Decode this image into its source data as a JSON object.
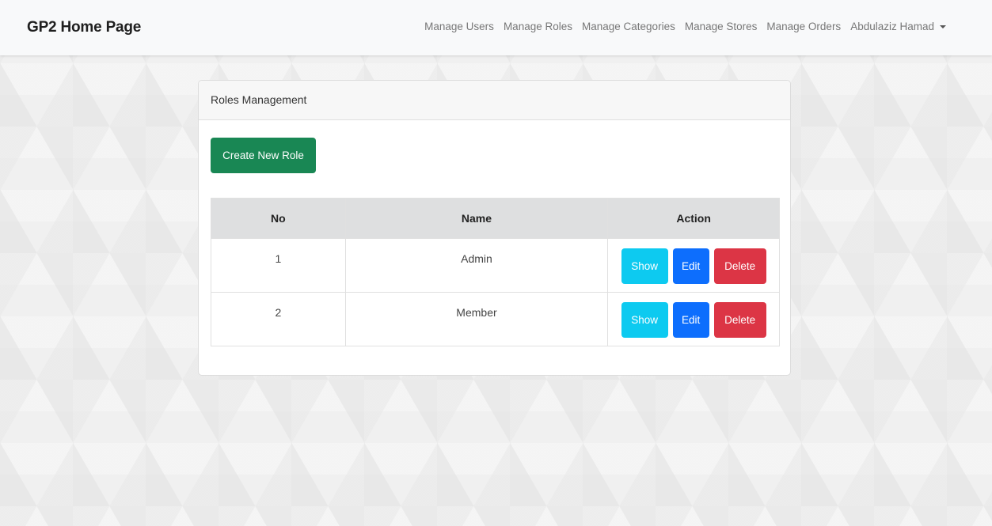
{
  "navbar": {
    "brand": "GP2 Home Page",
    "links": [
      "Manage Users",
      "Manage Roles",
      "Manage Categories",
      "Manage Stores",
      "Manage Orders"
    ],
    "user": "Abdulaziz Hamad"
  },
  "card": {
    "header": "Roles Management",
    "create_button": "Create New Role",
    "columns": [
      "No",
      "Name",
      "Action"
    ],
    "rows": [
      {
        "no": "1",
        "name": "Admin"
      },
      {
        "no": "2",
        "name": "Member"
      }
    ],
    "actions": {
      "show": "Show",
      "edit": "Edit",
      "delete": "Delete"
    }
  },
  "colors": {
    "create": "#198754",
    "show": "#0dcaf0",
    "edit": "#0d6efd",
    "delete": "#dc3545"
  }
}
